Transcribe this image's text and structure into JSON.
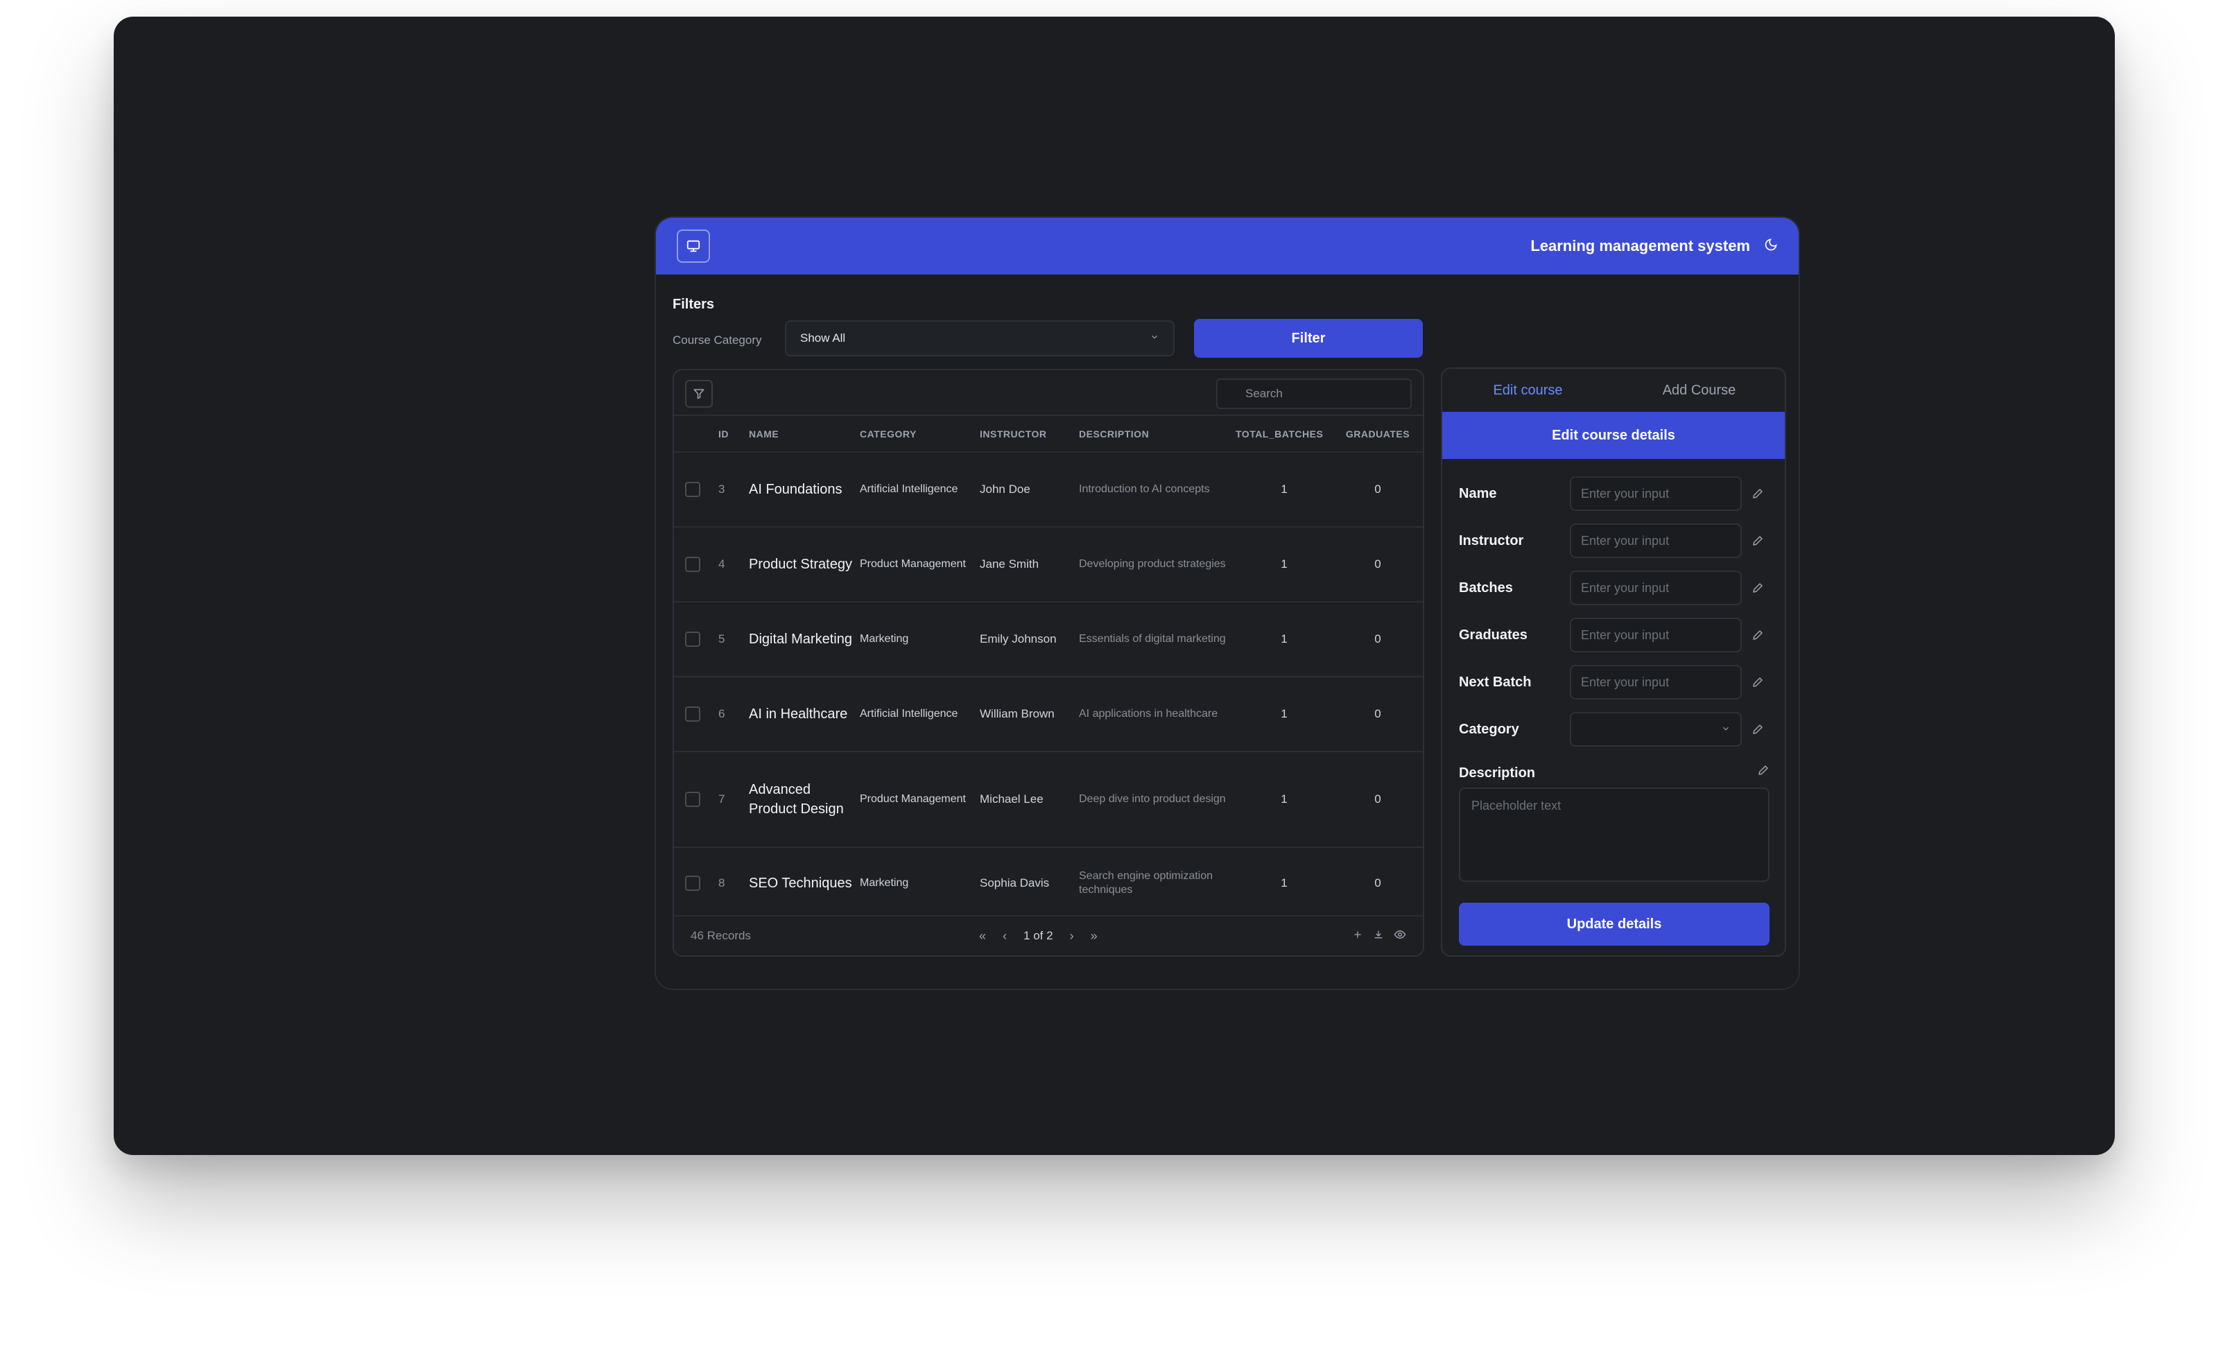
{
  "header": {
    "title": "Learning management system",
    "logo_icon": "monitor-icon",
    "theme_icon": "moon-icon"
  },
  "filters": {
    "title": "Filters",
    "category_label": "Course Category",
    "category_value": "Show All",
    "filter_button": "Filter"
  },
  "table": {
    "search_placeholder": "Search",
    "columns": {
      "id": "ID",
      "name": "NAME",
      "category": "CATEGORY",
      "instructor": "INSTRUCTOR",
      "description": "DESCRIPTION",
      "total_batches": "TOTAL_BATCHES",
      "graduates": "GRADUATES"
    },
    "rows": [
      {
        "id": "3",
        "name": "AI Foundations",
        "category": "Artificial Intelligence",
        "instructor": "John Doe",
        "description": "Introduction to AI concepts",
        "total_batches": "1",
        "graduates": "0"
      },
      {
        "id": "4",
        "name": "Product Strategy",
        "category": "Product Management",
        "instructor": "Jane Smith",
        "description": "Developing product strategies",
        "total_batches": "1",
        "graduates": "0"
      },
      {
        "id": "5",
        "name": "Digital Marketing",
        "category": "Marketing",
        "instructor": "Emily Johnson",
        "description": "Essentials of digital marketing",
        "total_batches": "1",
        "graduates": "0"
      },
      {
        "id": "6",
        "name": "AI in Healthcare",
        "category": "Artificial Intelligence",
        "instructor": "William Brown",
        "description": "AI applications in healthcare",
        "total_batches": "1",
        "graduates": "0"
      },
      {
        "id": "7",
        "name": "Advanced Product Design",
        "category": "Product Management",
        "instructor": "Michael Lee",
        "description": "Deep dive into product design",
        "total_batches": "1",
        "graduates": "0"
      },
      {
        "id": "8",
        "name": "SEO Techniques",
        "category": "Marketing",
        "instructor": "Sophia Davis",
        "description": "Search engine optimization techniques",
        "total_batches": "1",
        "graduates": "0"
      }
    ],
    "records": "46 Records",
    "page": "1 of 2"
  },
  "edit": {
    "tab_edit": "Edit course",
    "tab_add": "Add Course",
    "header": "Edit course details",
    "input_placeholder": "Enter your input",
    "fields": {
      "name": "Name",
      "instructor": "Instructor",
      "batches": "Batches",
      "graduates": "Graduates",
      "next_batch": "Next Batch",
      "category": "Category",
      "description": "Description"
    },
    "description_placeholder": "Placeholder text",
    "update_button": "Update details"
  },
  "colors": {
    "accent": "#3b4bd6",
    "active_tab": "#6b8cff",
    "background": "#1b1d21"
  }
}
